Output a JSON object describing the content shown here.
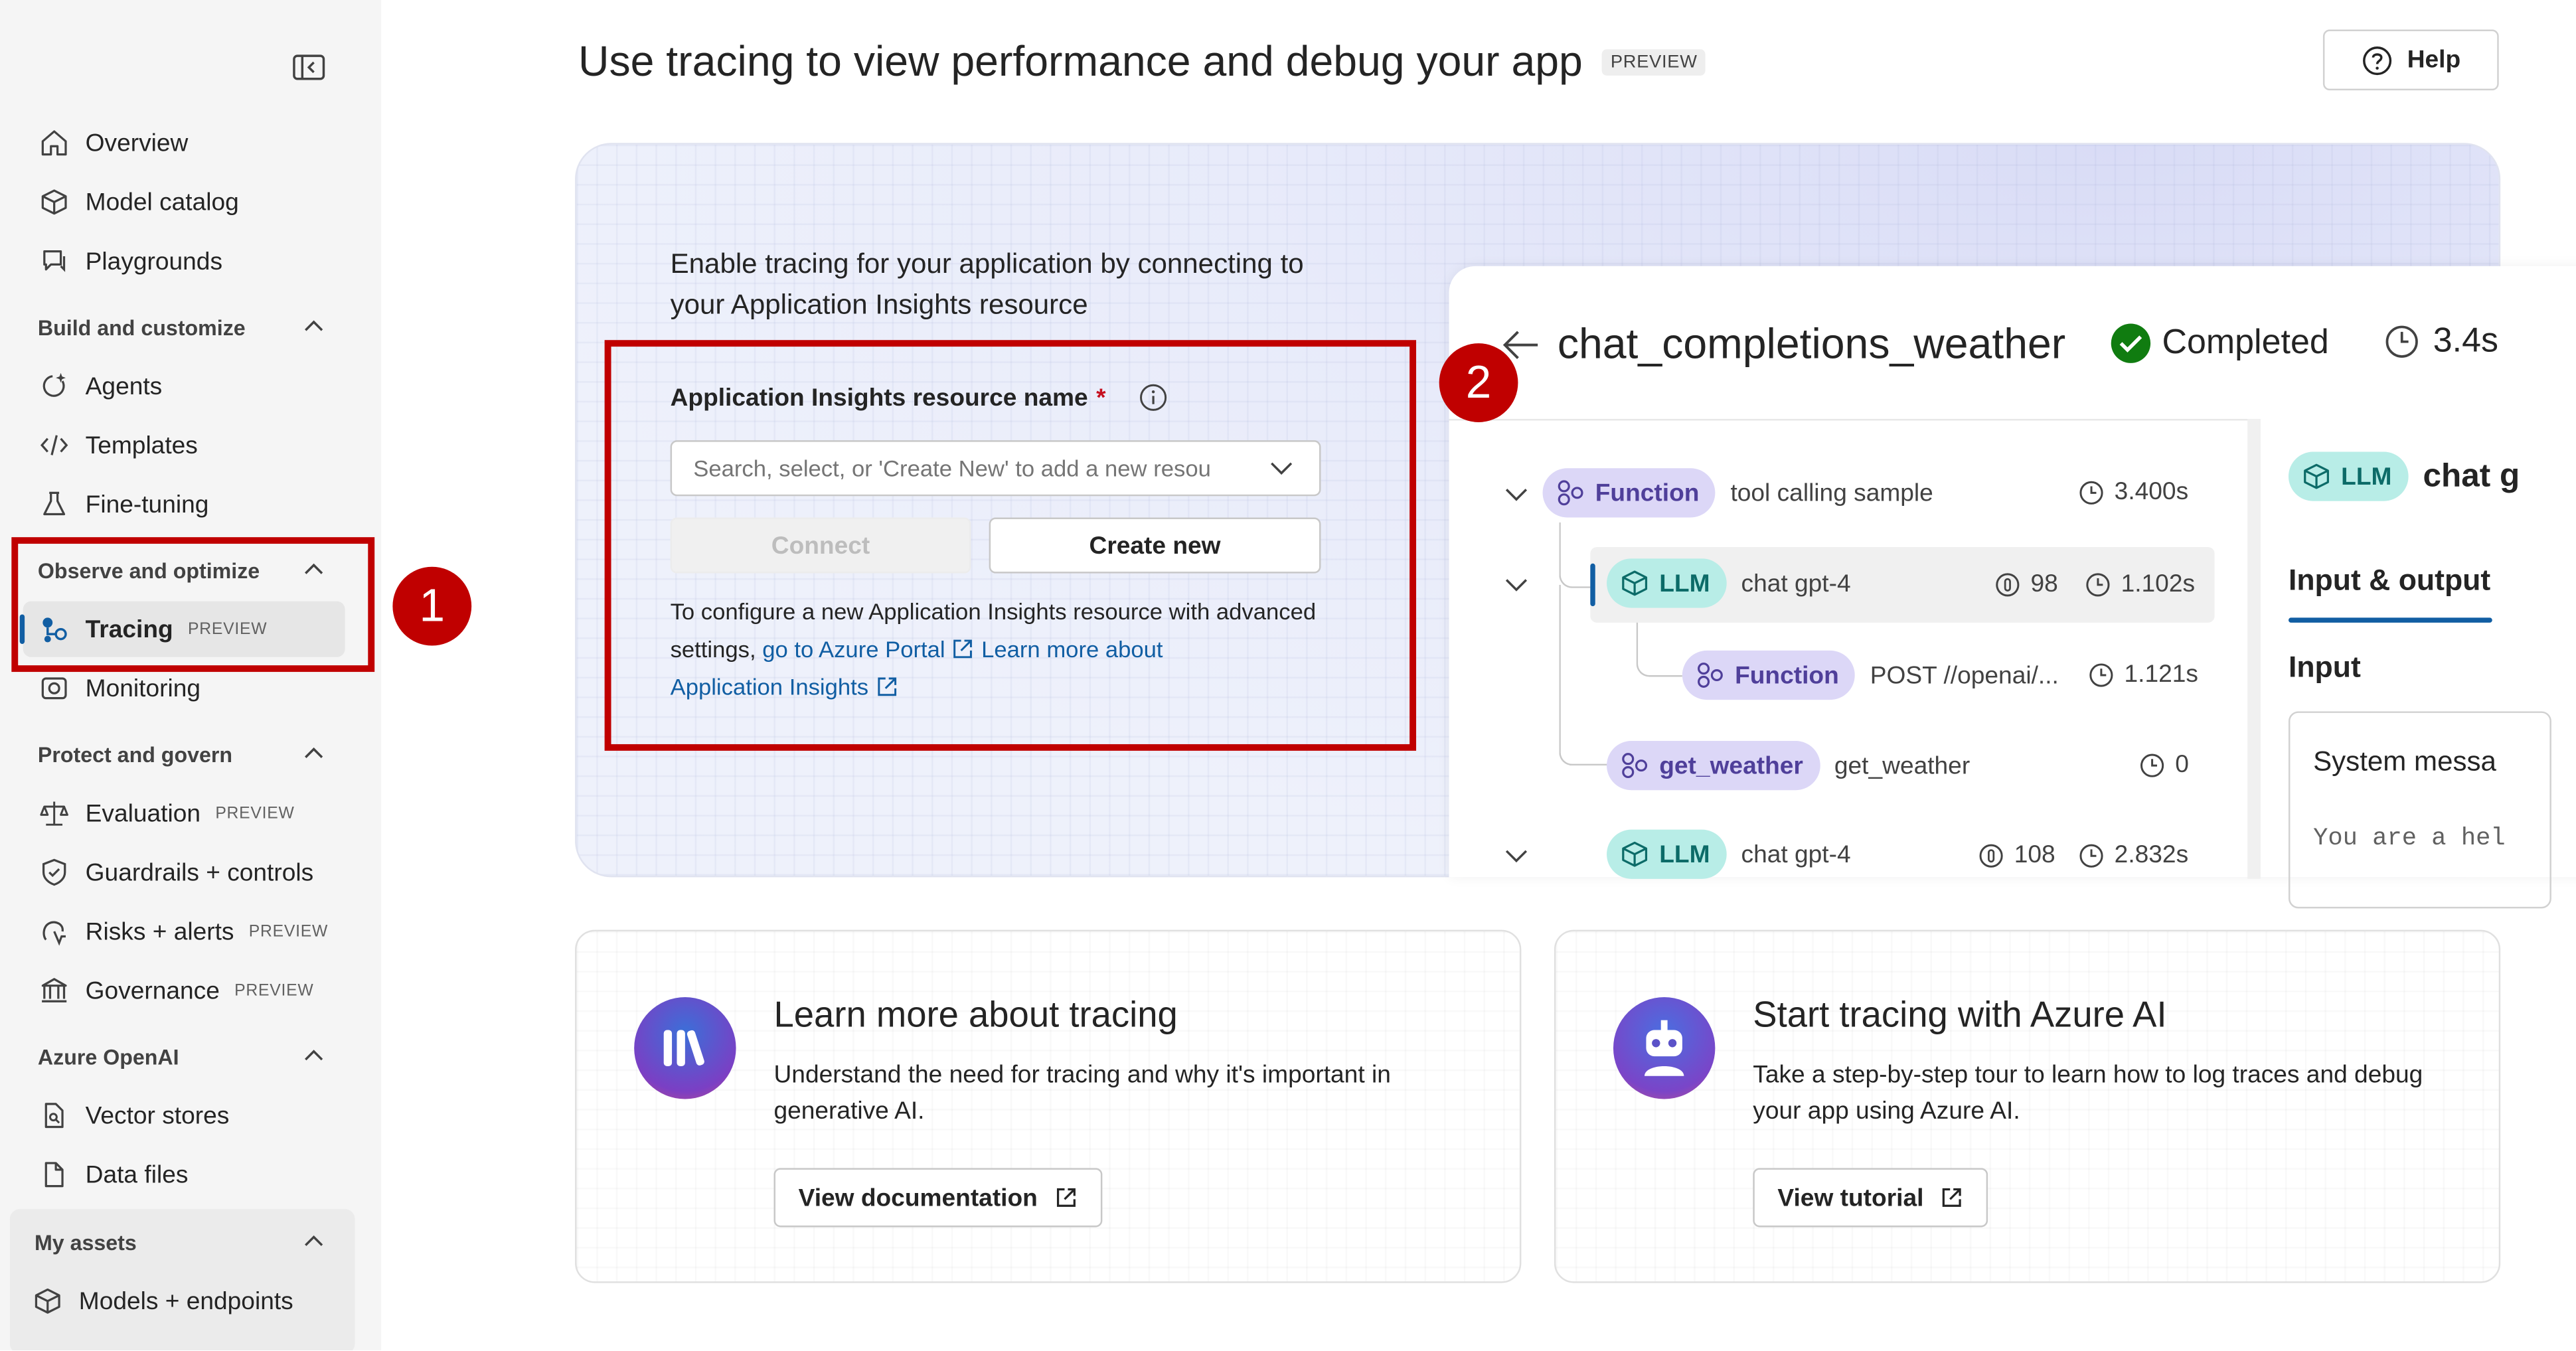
{
  "sidebar": {
    "items": [
      {
        "label": "Overview"
      },
      {
        "label": "Model catalog"
      },
      {
        "label": "Playgrounds"
      },
      {
        "label": "Agents"
      },
      {
        "label": "Templates"
      },
      {
        "label": "Fine-tuning"
      },
      {
        "label": "Tracing",
        "tag": "PREVIEW"
      },
      {
        "label": "Monitoring"
      },
      {
        "label": "Evaluation",
        "tag": "PREVIEW"
      },
      {
        "label": "Guardrails + controls"
      },
      {
        "label": "Risks + alerts",
        "tag": "PREVIEW"
      },
      {
        "label": "Governance",
        "tag": "PREVIEW"
      },
      {
        "label": "Vector stores"
      },
      {
        "label": "Data files"
      },
      {
        "label": "Models + endpoints"
      }
    ],
    "sections": [
      {
        "label": "Build and customize"
      },
      {
        "label": "Observe and optimize"
      },
      {
        "label": "Protect and govern"
      },
      {
        "label": "Azure OpenAI"
      },
      {
        "label": "My assets"
      }
    ]
  },
  "annotations": {
    "badge1": "1",
    "badge2": "2",
    "color": "#c00000"
  },
  "header": {
    "title": "Use tracing to view performance and debug your app",
    "preview": "PREVIEW",
    "help": "Help"
  },
  "hero": {
    "intro": "Enable tracing for your application by connecting to your Application Insights resource",
    "field_label": "Application Insights resource name",
    "required_mark": "*",
    "search_placeholder": "Search, select, or 'Create New' to add a new resou",
    "connect": "Connect",
    "create_new": "Create new",
    "config_text": "To configure a new Application Insights resource with advanced settings,",
    "portal_link": "go to Azure Portal",
    "learn_link_1": "Learn more about",
    "learn_link_2": "Application Insights"
  },
  "trace_preview": {
    "title": "chat_completions_weather",
    "status": "Completed",
    "duration": "3.4s",
    "rows": [
      {
        "kind": "Function",
        "name": "tool calling sample",
        "time": "3.400s"
      },
      {
        "kind": "LLM",
        "name": "chat gpt-4",
        "tokens": "98",
        "time": "1.102s"
      },
      {
        "kind": "Function",
        "name": "POST //openai/...",
        "time": "1.121s"
      },
      {
        "kind": "get_weather",
        "name": "get_weather",
        "time": "0"
      },
      {
        "kind": "LLM",
        "name": "chat gpt-4",
        "tokens": "108",
        "time": "2.832s"
      }
    ],
    "right_pill": "LLM",
    "right_name": "chat g",
    "io_tab": "Input & output",
    "input_label": "Input",
    "system_title": "System messa",
    "system_code": "You are a hel"
  },
  "cards": [
    {
      "title": "Learn more about tracing",
      "desc": "Understand the need for tracing and why it's important in generative AI.",
      "button": "View documentation"
    },
    {
      "title": "Start tracing with Azure AI",
      "desc": "Take a step-by-step tour to learn how to log traces and debug your app using Azure AI.",
      "button": "View tutorial"
    }
  ]
}
